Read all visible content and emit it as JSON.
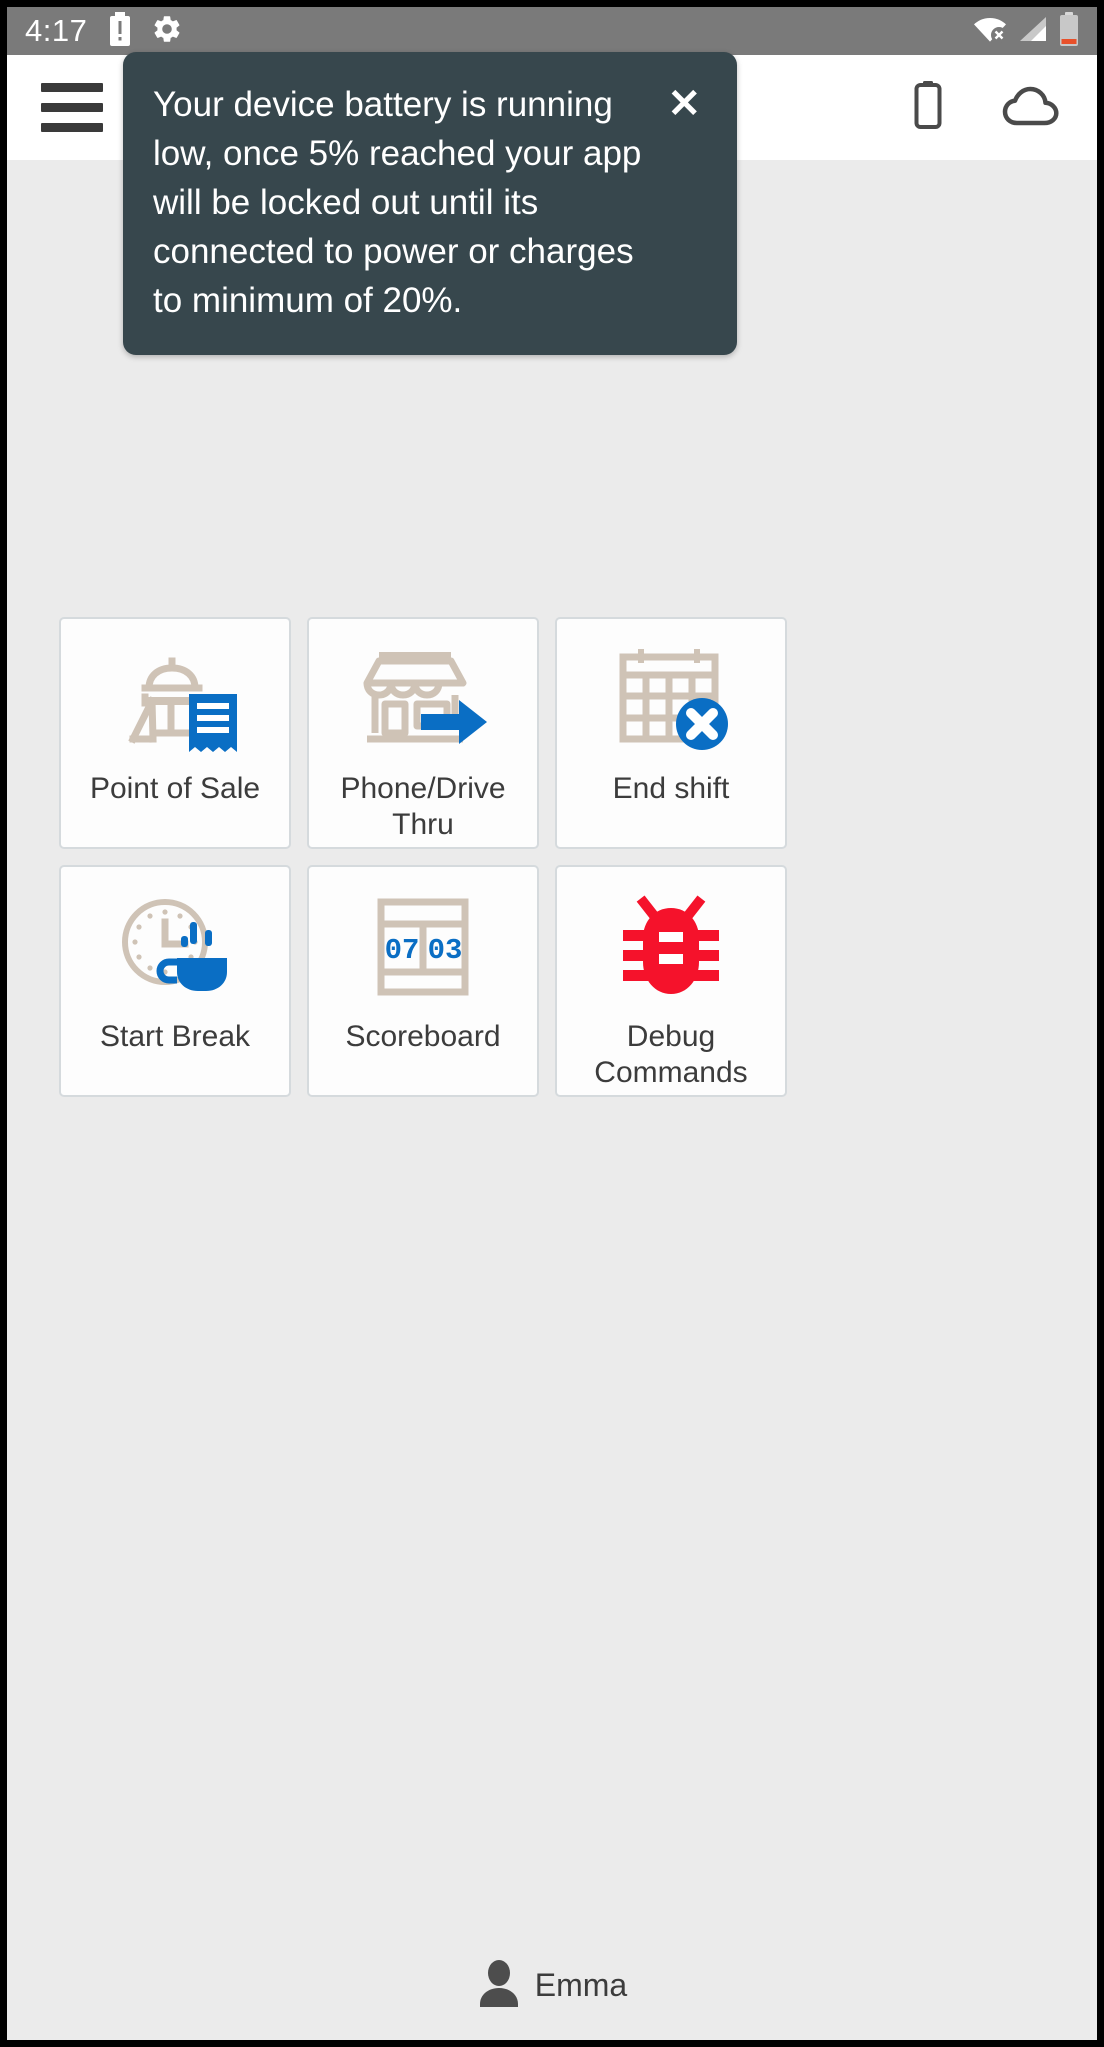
{
  "statusbar": {
    "time": "4:17",
    "left_icons": [
      "battery-alert-icon",
      "gear-icon"
    ],
    "right_icons": [
      "wifi-off-icon",
      "cellular-signal-icon",
      "battery-low-icon"
    ]
  },
  "appbar": {
    "menu_icon": "hamburger-menu-icon",
    "actions": [
      "battery-icon",
      "cloud-icon"
    ]
  },
  "tooltip": {
    "message": "Your device battery is running low, once 5% reached your app will be locked out until its connected to power or charges to minimum of 20%.",
    "close_label": "✕"
  },
  "tiles": [
    {
      "label": "Point of Sale",
      "icon": "point-of-sale-icon"
    },
    {
      "label": "Phone/Drive Thru",
      "icon": "phone-drive-thru-icon"
    },
    {
      "label": "End shift",
      "icon": "end-shift-icon"
    },
    {
      "label": "Start Break",
      "icon": "start-break-icon"
    },
    {
      "label": "Scoreboard",
      "icon": "scoreboard-icon"
    },
    {
      "label": "Debug Commands",
      "icon": "debug-bug-icon"
    }
  ],
  "scoreboard": {
    "left_value": "07",
    "right_value": "03"
  },
  "footer": {
    "user_name": "Emma",
    "user_icon": "person-icon"
  },
  "colors": {
    "accent_blue": "#0a6ec4",
    "icon_tan": "#cfc3b6",
    "debug_red": "#f5122b",
    "tooltip_bg": "#37474d",
    "page_bg": "#ebebeb",
    "statusbar_bg": "#7a7a7a"
  }
}
